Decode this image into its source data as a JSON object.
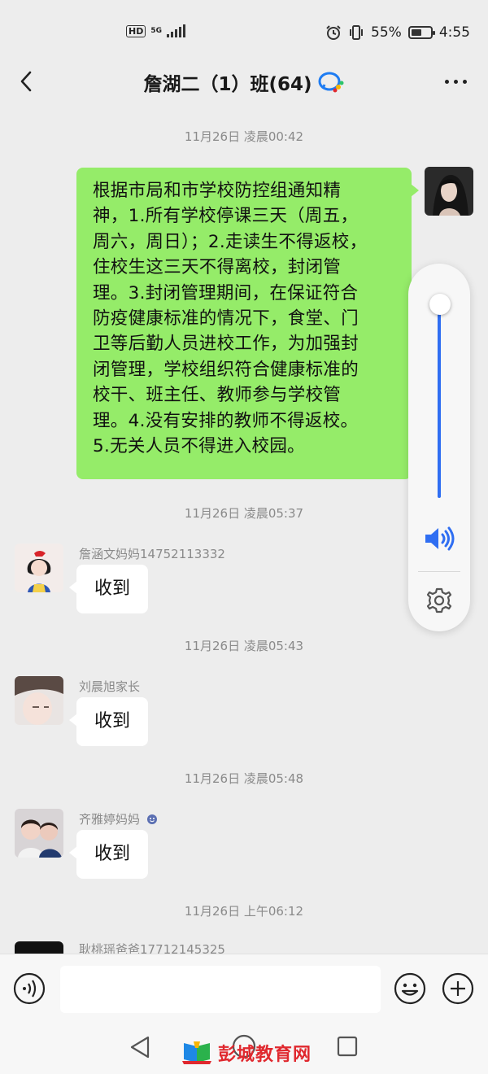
{
  "status_bar": {
    "hd": "HD",
    "network": "5G",
    "battery": "55%",
    "battery_level": 0.55,
    "time": "4:55"
  },
  "header": {
    "title": "詹湖二（1）班(64)"
  },
  "messages": [
    {
      "time": "11月26日 凌晨00:42",
      "direction": "out",
      "lines": [
        "根据市局和市学校防控组通知精",
        "神，1.所有学校停课三天（周五，",
        "周六，周日）；2.走读生不得返校，",
        "住校生这三天不得离校，封闭管",
        "理。3.封闭管理期间，在保证符合",
        "防疫健康标准的情况下，食堂、门",
        "卫等后勤人员进校工作，为加强封",
        "闭管理，学校组织符合健康标准的",
        "校干、班主任、教师参与学校管",
        "理。4.没有安排的教师不得返校。",
        "5.无关人员不得进入校园。"
      ]
    },
    {
      "time": "11月26日 凌晨05:37",
      "direction": "in",
      "sender": "詹涵文妈妈14752113332",
      "text": "收到"
    },
    {
      "time": "11月26日 凌晨05:43",
      "direction": "in",
      "sender": "刘晨旭家长",
      "text": "收到"
    },
    {
      "time": "11月26日 凌晨05:48",
      "direction": "in",
      "sender": "齐雅婷妈妈",
      "text": "收到"
    },
    {
      "time": "11月26日 上午06:12",
      "direction": "in",
      "sender": "耿桃瑶爸爸17712145325",
      "text": ""
    }
  ],
  "volume": {
    "level": 0.96
  },
  "input": {
    "placeholder": ""
  },
  "watermark": {
    "text": "彭城教育网"
  },
  "colors": {
    "bubble_out": "#95ec69",
    "bubble_in": "#ffffff",
    "volume_accent": "#2f6ef2",
    "watermark": "#e0282e"
  }
}
